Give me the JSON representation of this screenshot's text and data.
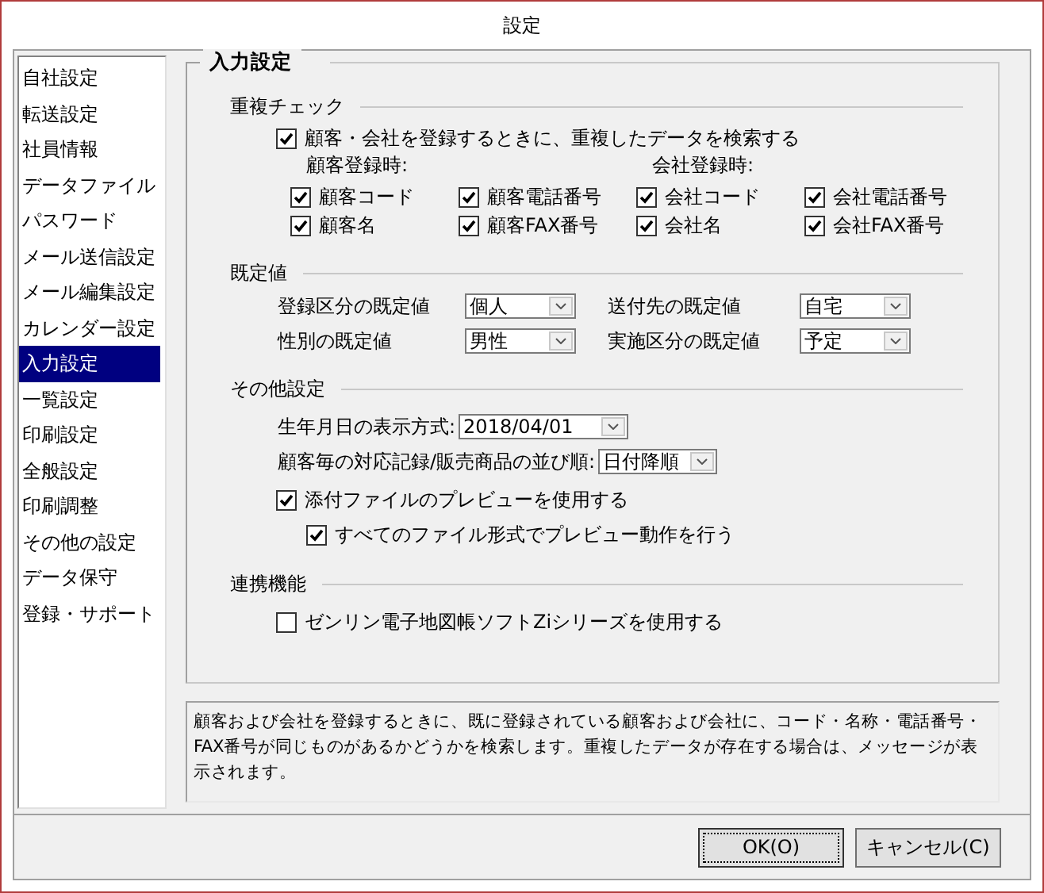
{
  "window": {
    "title": "設定"
  },
  "sidebar": {
    "items": [
      {
        "label": "自社設定",
        "selected": false
      },
      {
        "label": "転送設定",
        "selected": false
      },
      {
        "label": "社員情報",
        "selected": false
      },
      {
        "label": "データファイル",
        "selected": false
      },
      {
        "label": "パスワード",
        "selected": false
      },
      {
        "label": "メール送信設定",
        "selected": false
      },
      {
        "label": "メール編集設定",
        "selected": false
      },
      {
        "label": "カレンダー設定",
        "selected": false
      },
      {
        "label": "入力設定",
        "selected": true
      },
      {
        "label": "一覧設定",
        "selected": false
      },
      {
        "label": "印刷設定",
        "selected": false
      },
      {
        "label": "全般設定",
        "selected": false
      },
      {
        "label": "印刷調整",
        "selected": false
      },
      {
        "label": "その他の設定",
        "selected": false
      },
      {
        "label": "データ保守",
        "selected": false
      },
      {
        "label": "登録・サポート",
        "selected": false
      }
    ]
  },
  "panel": {
    "title": "入力設定",
    "duplicate_check": {
      "title": "重複チェック",
      "main": {
        "label": "顧客・会社を登録するときに、重複したデータを検索する",
        "checked": true
      },
      "groups": [
        {
          "title": "顧客登録時:",
          "options": [
            {
              "label": "顧客コード",
              "checked": true
            },
            {
              "label": "顧客電話番号",
              "checked": true
            },
            {
              "label": "顧客名",
              "checked": true
            },
            {
              "label": "顧客FAX番号",
              "checked": true
            }
          ]
        },
        {
          "title": "会社登録時:",
          "options": [
            {
              "label": "会社コード",
              "checked": true
            },
            {
              "label": "会社電話番号",
              "checked": true
            },
            {
              "label": "会社名",
              "checked": true
            },
            {
              "label": "会社FAX番号",
              "checked": true
            }
          ]
        }
      ]
    },
    "defaults": {
      "title": "既定値",
      "fields": [
        {
          "label": "登録区分の既定値",
          "value": "個人"
        },
        {
          "label": "送付先の既定値",
          "value": "自宅"
        },
        {
          "label": "性別の既定値",
          "value": "男性"
        },
        {
          "label": "実施区分の既定値",
          "value": "予定"
        }
      ]
    },
    "other": {
      "title": "その他設定",
      "fields": [
        {
          "label": "生年月日の表示方式:",
          "value": "2018/04/01"
        },
        {
          "label": "顧客毎の対応記録/販売商品の並び順:",
          "value": "日付降順"
        }
      ],
      "checks": [
        {
          "label": "添付ファイルのプレビューを使用する",
          "checked": true,
          "children": [
            {
              "label": "すべてのファイル形式でプレビュー動作を行う",
              "checked": true
            }
          ]
        }
      ]
    },
    "integration": {
      "title": "連携機能",
      "checks": [
        {
          "label": "ゼンリン電子地図帳ソフトZiシリーズを使用する",
          "checked": false
        }
      ]
    }
  },
  "description": {
    "text": "顧客および会社を登録するときに、既に登録されている顧客および会社に、コード・名称・電話番号・FAX番号が同じものがあるかどうかを検索します。重複したデータが存在する場合は、メッセージが表示されます。"
  },
  "buttons": [
    {
      "label": "OK(O)",
      "focused": true
    },
    {
      "label": "キャンセル(C)",
      "focused": false
    }
  ]
}
